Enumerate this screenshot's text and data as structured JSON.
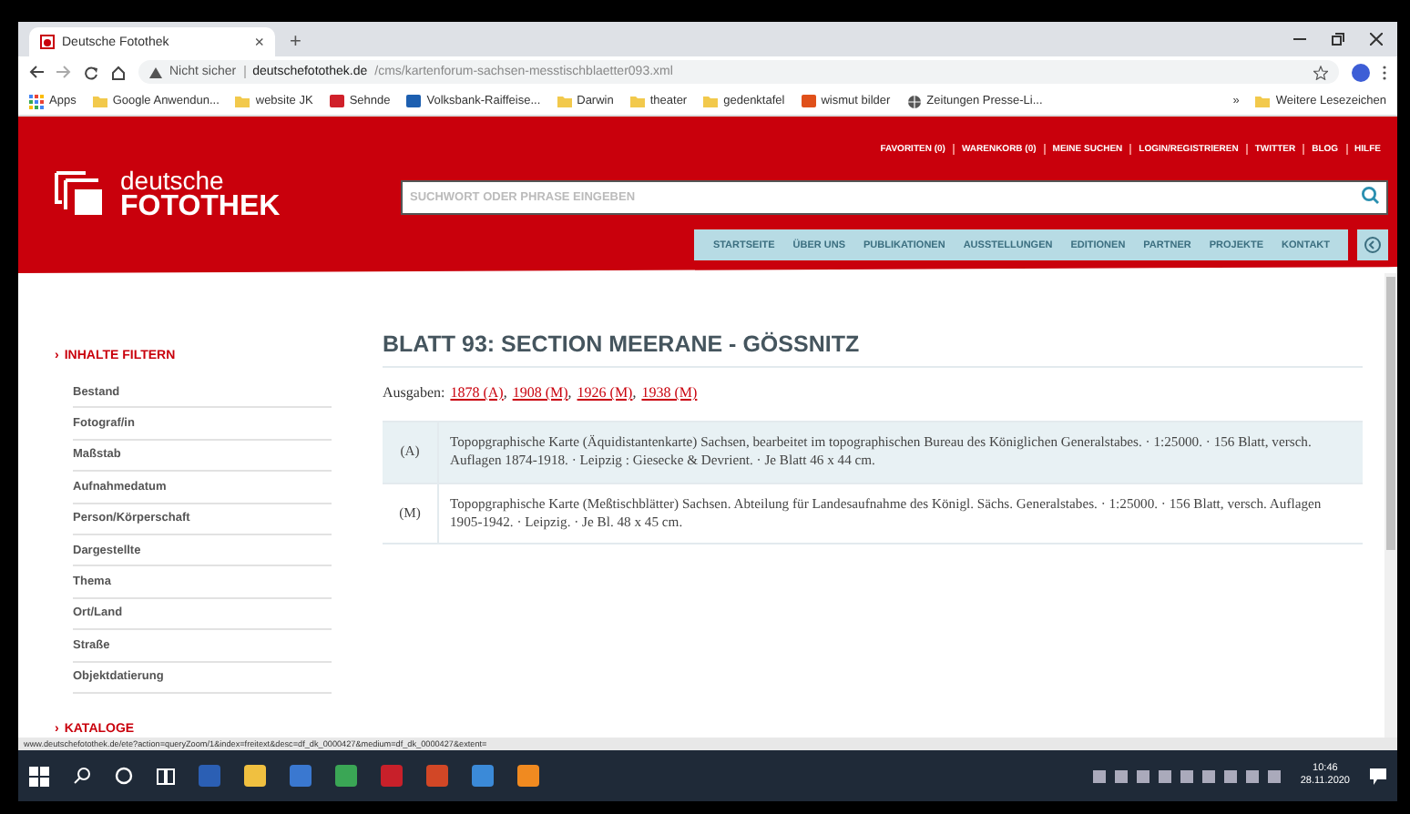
{
  "browser": {
    "tab": {
      "title": "Deutsche Fotothek",
      "close": "×"
    },
    "new_tab": "+",
    "security": "Nicht sicher",
    "url_host": "deutschefotothek.de",
    "url_path": "/cms/kartenforum-sachsen-messtischblaetter093.xml",
    "bookmarks": [
      {
        "label": "Apps",
        "kind": "apps"
      },
      {
        "label": "Google Anwendun...",
        "kind": "folder"
      },
      {
        "label": "website JK",
        "kind": "folder"
      },
      {
        "label": "Sehnde",
        "kind": "site",
        "color": "#d0202a"
      },
      {
        "label": "Volksbank-Raiffeise...",
        "kind": "site",
        "color": "#1d5fb0"
      },
      {
        "label": "Darwin",
        "kind": "folder"
      },
      {
        "label": "theater",
        "kind": "folder"
      },
      {
        "label": "gedenktafel",
        "kind": "folder"
      },
      {
        "label": "wismut bilder",
        "kind": "site",
        "color": "#e0501a"
      },
      {
        "label": "Zeitungen Presse-Li...",
        "kind": "globe"
      }
    ],
    "bookmarks_more": "»",
    "other_bookmarks": "Weitere Lesezeichen"
  },
  "header": {
    "logo": {
      "line1": "deutsche",
      "line2": "FOTOTHEK"
    },
    "top_links": [
      "FAVORITEN (0)",
      "WARENKORB (0)",
      "MEINE SUCHEN",
      "LOGIN/REGISTRIEREN",
      "TWITTER",
      "BLOG",
      "HILFE"
    ],
    "search": {
      "placeholder": "SUCHWORT ODER PHRASE EINGEBEN"
    },
    "nav": [
      "STARTSEITE",
      "ÜBER UNS",
      "PUBLIKATIONEN",
      "AUSSTELLUNGEN",
      "EDITIONEN",
      "PARTNER",
      "PROJEKTE",
      "KONTAKT"
    ]
  },
  "sidebar": {
    "heading": "INHALTE FILTERN",
    "arrow": "›",
    "filters": [
      "Bestand",
      "Fotograf/in",
      "Maßstab",
      "Aufnahmedatum",
      "Person/Körperschaft",
      "Dargestellte",
      "Thema",
      "Ort/Land",
      "Straße",
      "Objektdatierung"
    ],
    "bottom_heading": "KATALOGE"
  },
  "main": {
    "title": "BLATT 93: SECTION MEERANE - GÖSSNITZ",
    "editions_label": "Ausgaben:",
    "editions": [
      {
        "label": "1878 (A)",
        "suffix": ","
      },
      {
        "label": "1908 (M)",
        "suffix": ","
      },
      {
        "label": "1926 (M)",
        "suffix": ","
      },
      {
        "label": "1938 (M)"
      }
    ],
    "records": [
      {
        "code": "(A)",
        "text": "Topopgraphische Karte (Äquidistantenkarte) Sachsen, bearbeitet im topographischen Bureau des Königlichen Generalstabes. · 1:25000. · 156 Blatt, versch. Auflagen 1874-1918. · Leipzig : Giesecke & Devrient. · Je Blatt 46 x 44 cm.",
        "selected": true
      },
      {
        "code": "(M)",
        "text": "Topopgraphische Karte (Meßtischblätter) Sachsen. Abteilung für Landesaufnahme des Königl. Sächs. Generalstabes. · 1:25000. · 156 Blatt, versch. Auflagen 1905-1942. · Leipzig. · Je Bl. 48 x 45 cm.",
        "selected": false
      }
    ]
  },
  "status_url": "www.deutschefotothek.de/ete?action=queryZoom/1&index=freitext&desc=df_dk_0000427&medium=df_dk_0000427&extent=",
  "taskbar": {
    "apps": [
      {
        "color": "#2b5fb4"
      },
      {
        "color": "#f0c040"
      },
      {
        "color": "#3a78d0"
      },
      {
        "color": "#3aa655"
      },
      {
        "color": "#c8202a"
      },
      {
        "color": "#d24726"
      },
      {
        "color": "#3b8ad8"
      },
      {
        "color": "#f08a20"
      }
    ],
    "time": "10:46",
    "date": "28.11.2020"
  }
}
